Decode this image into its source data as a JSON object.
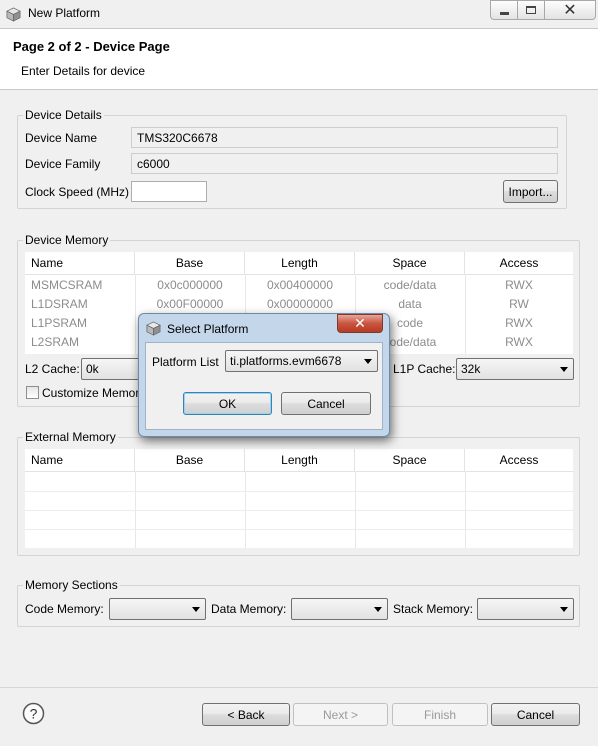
{
  "window": {
    "title": "New Platform"
  },
  "header": {
    "title": "Page 2 of 2 - Device Page",
    "subtitle": "Enter Details for device"
  },
  "device_details": {
    "group_label": "Device Details",
    "device_name_label": "Device Name",
    "device_name_value": "TMS320C6678",
    "device_family_label": "Device Family",
    "device_family_value": "c6000",
    "clock_speed_label": "Clock Speed (MHz)",
    "clock_speed_value": "",
    "import_label": "Import..."
  },
  "device_memory": {
    "group_label": "Device Memory",
    "columns": [
      "Name",
      "Base",
      "Length",
      "Space",
      "Access"
    ],
    "rows": [
      [
        "MSMCSRAM",
        "0x0c000000",
        "0x00400000",
        "code/data",
        "RWX"
      ],
      [
        "L1DSRAM",
        "0x00F00000",
        "0x00000000",
        "data",
        "RW"
      ],
      [
        "L1PSRAM",
        "",
        "",
        "code",
        "RWX"
      ],
      [
        "L2SRAM",
        "",
        "",
        "code/data",
        "RWX"
      ]
    ],
    "l2_cache_label": "L2 Cache:",
    "l2_cache_value": "0k",
    "l1p_cache_label": "L1P Cache:",
    "l1p_cache_value": "32k",
    "customize_label": "Customize Memor"
  },
  "external_memory": {
    "group_label": "External Memory",
    "columns": [
      "Name",
      "Base",
      "Length",
      "Space",
      "Access"
    ]
  },
  "memory_sections": {
    "group_label": "Memory Sections",
    "code_label": "Code Memory:",
    "data_label": "Data Memory:",
    "stack_label": "Stack Memory:",
    "code_value": "",
    "data_value": "",
    "stack_value": ""
  },
  "footer": {
    "back": "< Back",
    "next": "Next >",
    "finish": "Finish",
    "cancel": "Cancel"
  },
  "dialog": {
    "title": "Select Platform",
    "platform_list_label": "Platform List",
    "platform_value": "ti.platforms.evm6678",
    "ok": "OK",
    "cancel": "Cancel"
  }
}
